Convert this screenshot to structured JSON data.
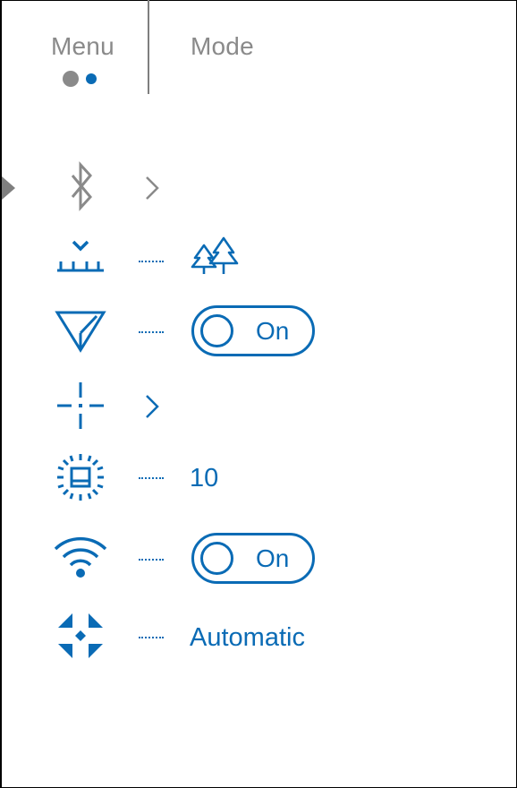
{
  "colors": {
    "accent": "#0a6bb5",
    "inactive": "#8a8a8a"
  },
  "tabs": [
    {
      "label": "Menu",
      "active": true
    },
    {
      "label": "Mode",
      "active": false
    }
  ],
  "menu_items": [
    {
      "icon": "bluetooth-icon",
      "type": "submenu"
    },
    {
      "icon": "rangefinder-icon",
      "type": "value",
      "value_icon": "forest-trees-icon"
    },
    {
      "icon": "location-arrow-icon",
      "type": "toggle",
      "value": "On"
    },
    {
      "icon": "crosshair-icon",
      "type": "submenu"
    },
    {
      "icon": "display-brightness-icon",
      "type": "value",
      "value": "10"
    },
    {
      "icon": "wifi-icon",
      "type": "toggle",
      "value": "On"
    },
    {
      "icon": "auto-shutdown-icon",
      "type": "value",
      "value": "Automatic"
    }
  ]
}
